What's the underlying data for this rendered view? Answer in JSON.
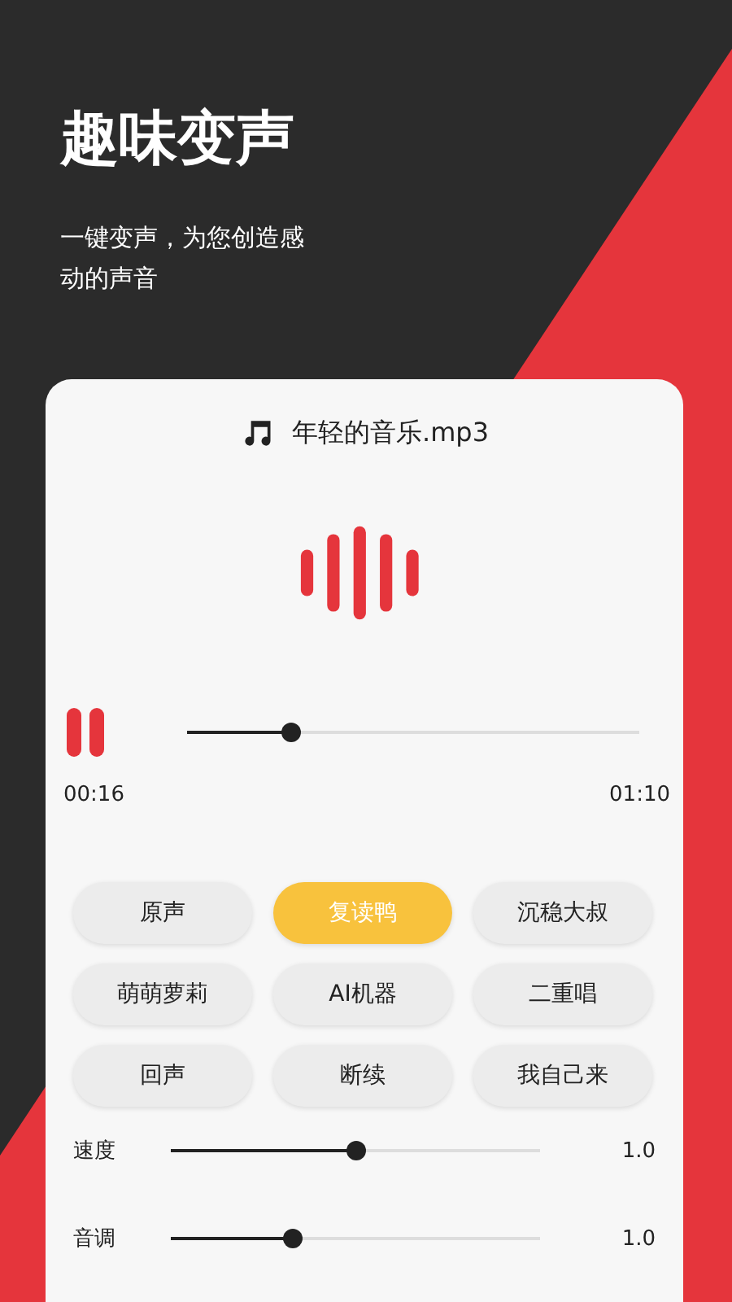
{
  "header": {
    "title": "趣味变声",
    "subtitle": "一键变声，为您创造感动的声音"
  },
  "player": {
    "file_name": "年轻的音乐.mp3",
    "playing": true,
    "level": 0.23,
    "elapsed": "00:16",
    "duration": "01:10"
  },
  "voices": [
    {
      "label": "原声",
      "selected": false
    },
    {
      "label": "复读鸭",
      "selected": true
    },
    {
      "label": "沉稳大叔",
      "selected": false
    },
    {
      "label": "萌萌萝莉",
      "selected": false
    },
    {
      "label": "AI机器",
      "selected": false
    },
    {
      "label": "二重唱",
      "selected": false
    },
    {
      "label": "回声",
      "selected": false
    },
    {
      "label": "断续",
      "selected": false
    },
    {
      "label": "我自己来",
      "selected": false
    }
  ],
  "sliders": [
    {
      "label": "速度",
      "level": 0.5,
      "reading": "1.0"
    },
    {
      "label": "音调",
      "level": 0.33,
      "reading": "1.0"
    }
  ]
}
